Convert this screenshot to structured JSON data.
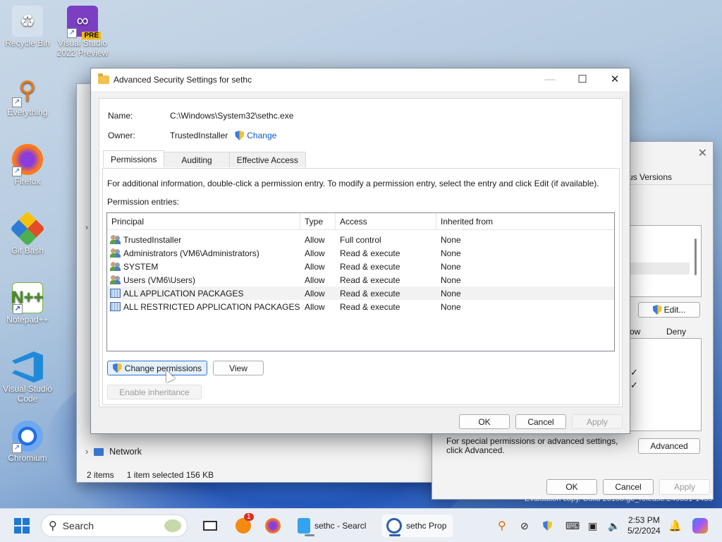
{
  "desktop": {
    "icons": [
      {
        "label": "Recycle Bin",
        "icon": "recycle-bin-icon"
      },
      {
        "label": "Visual Studio 2022 Preview",
        "icon": "visual-studio-icon",
        "badge": "PRE"
      },
      {
        "label": "Everything",
        "icon": "everything-search-icon"
      },
      {
        "label": "Firefox",
        "icon": "firefox-icon"
      },
      {
        "label": "Git Bash",
        "icon": "git-bash-icon"
      },
      {
        "label": "Notepad++",
        "icon": "notepadpp-icon"
      },
      {
        "label": "Visual Studio Code",
        "icon": "vscode-icon"
      },
      {
        "label": "Chromium",
        "icon": "chromium-icon"
      }
    ]
  },
  "explorer": {
    "nav_network": "Network",
    "status_items": "2 items",
    "status_selected": "1 item selected  156 KB"
  },
  "props": {
    "tab_prev_versions": "us Versions",
    "edit_button": "Edit...",
    "col_allow": "ow",
    "col_deny": "Deny",
    "help_text": "For special permissions or advanced settings, click Advanced.",
    "advanced_button": "Advanced",
    "ok": "OK",
    "cancel": "Cancel",
    "apply": "Apply",
    "watermark": "Evaluation copy. Build 26100.ge_release.240331-1435"
  },
  "dialog": {
    "title": "Advanced Security Settings for sethc",
    "name_label": "Name:",
    "name_value": "C:\\Windows\\System32\\sethc.exe",
    "owner_label": "Owner:",
    "owner_value": "TrustedInstaller",
    "change_link": "Change",
    "tabs": [
      "Permissions",
      "Auditing",
      "Effective Access"
    ],
    "info_text": "For additional information, double-click a permission entry. To modify a permission entry, select the entry and click Edit (if available).",
    "entries_label": "Permission entries:",
    "columns": [
      "Principal",
      "Type",
      "Access",
      "Inherited from"
    ],
    "rows": [
      {
        "principal": "TrustedInstaller",
        "type": "Allow",
        "access": "Full control",
        "inherited": "None",
        "icon": "users-icon"
      },
      {
        "principal": "Administrators (VM6\\Administrators)",
        "type": "Allow",
        "access": "Read & execute",
        "inherited": "None",
        "icon": "users-icon"
      },
      {
        "principal": "SYSTEM",
        "type": "Allow",
        "access": "Read & execute",
        "inherited": "None",
        "icon": "users-icon"
      },
      {
        "principal": "Users (VM6\\Users)",
        "type": "Allow",
        "access": "Read & execute",
        "inherited": "None",
        "icon": "users-icon"
      },
      {
        "principal": "ALL APPLICATION PACKAGES",
        "type": "Allow",
        "access": "Read & execute",
        "inherited": "None",
        "icon": "package-icon"
      },
      {
        "principal": "ALL RESTRICTED APPLICATION PACKAGES",
        "type": "Allow",
        "access": "Read & execute",
        "inherited": "None",
        "icon": "package-icon"
      }
    ],
    "change_permissions": "Change permissions",
    "view": "View",
    "enable_inheritance": "Enable inheritance",
    "ok": "OK",
    "cancel": "Cancel",
    "apply": "Apply"
  },
  "taskbar": {
    "search_placeholder": "Search",
    "notification_badge": "1",
    "explorer_task": "sethc - Searcl",
    "props_task": "sethc Prop",
    "time": "2:53 PM",
    "date": "5/2/2024"
  }
}
